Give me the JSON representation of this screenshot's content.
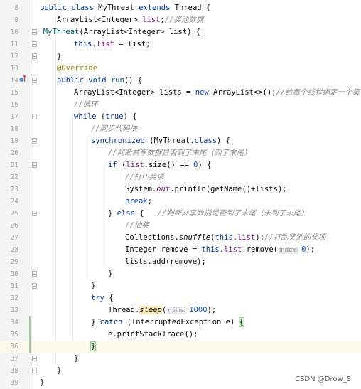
{
  "editor": {
    "lines": [
      {
        "n": "8",
        "indent": 0,
        "segs": [
          {
            "t": "public class ",
            "c": "kw"
          },
          {
            "t": "MyThreat ",
            "c": ""
          },
          {
            "t": "extends ",
            "c": "kw"
          },
          {
            "t": "Thread {",
            "c": ""
          }
        ]
      },
      {
        "n": "9",
        "indent": 1,
        "segs": [
          {
            "t": "ArrayList<Integer> ",
            "c": ""
          },
          {
            "t": "list",
            "c": "fld"
          },
          {
            "t": ";",
            "c": ""
          },
          {
            "t": "//奖池数据",
            "c": "cmt"
          }
        ]
      },
      {
        "n": "10",
        "indent": 0.2,
        "segs": [
          {
            "t": "MyThreat",
            "c": "fn"
          },
          {
            "t": "(ArrayList<Integer> list) {",
            "c": ""
          }
        ]
      },
      {
        "n": "11",
        "indent": 2,
        "segs": [
          {
            "t": "this",
            "c": "kw"
          },
          {
            "t": ".",
            "c": ""
          },
          {
            "t": "list",
            "c": "fld"
          },
          {
            "t": " = list;",
            "c": ""
          }
        ]
      },
      {
        "n": "12",
        "indent": 1,
        "segs": [
          {
            "t": "}",
            "c": ""
          }
        ]
      },
      {
        "n": "13",
        "indent": 1,
        "segs": [
          {
            "t": "@Override",
            "c": "ann"
          }
        ]
      },
      {
        "n": "14",
        "indent": 1,
        "segs": [
          {
            "t": "public void ",
            "c": "kw"
          },
          {
            "t": "run",
            "c": "fn"
          },
          {
            "t": "() {",
            "c": ""
          }
        ]
      },
      {
        "n": "15",
        "indent": 2,
        "segs": [
          {
            "t": "ArrayList<Integer> lists = ",
            "c": ""
          },
          {
            "t": "new ",
            "c": "kw"
          },
          {
            "t": "ArrayList<>();",
            "c": ""
          },
          {
            "t": "//给每个线程绑定一个集合",
            "c": "cmt"
          }
        ]
      },
      {
        "n": "16",
        "indent": 2,
        "segs": [
          {
            "t": "//循环",
            "c": "cmt"
          }
        ]
      },
      {
        "n": "17",
        "indent": 2,
        "segs": [
          {
            "t": "while ",
            "c": "kw"
          },
          {
            "t": "(",
            "c": ""
          },
          {
            "t": "true",
            "c": "kw"
          },
          {
            "t": ") {",
            "c": ""
          }
        ]
      },
      {
        "n": "18",
        "indent": 3,
        "segs": [
          {
            "t": "//同步代码块",
            "c": "cmt"
          }
        ]
      },
      {
        "n": "19",
        "indent": 3,
        "segs": [
          {
            "t": "synchronized ",
            "c": "kw"
          },
          {
            "t": "(MyThreat.",
            "c": ""
          },
          {
            "t": "class",
            "c": "kw"
          },
          {
            "t": ") {",
            "c": ""
          }
        ]
      },
      {
        "n": "20",
        "indent": 4,
        "segs": [
          {
            "t": "//判断共享数据是否到了末尾（到了末尾）",
            "c": "cmt"
          }
        ]
      },
      {
        "n": "21",
        "indent": 4,
        "segs": [
          {
            "t": "if ",
            "c": "kw"
          },
          {
            "t": "(",
            "c": ""
          },
          {
            "t": "list",
            "c": "fld"
          },
          {
            "t": ".size() == ",
            "c": ""
          },
          {
            "t": "0",
            "c": "num"
          },
          {
            "t": ") {",
            "c": ""
          }
        ]
      },
      {
        "n": "22",
        "indent": 5,
        "segs": [
          {
            "t": "//打印奖项",
            "c": "cmt"
          }
        ]
      },
      {
        "n": "23",
        "indent": 5,
        "segs": [
          {
            "t": "System.",
            "c": ""
          },
          {
            "t": "out",
            "c": "fld st"
          },
          {
            "t": ".println(getName()+lists);",
            "c": ""
          }
        ]
      },
      {
        "n": "24",
        "indent": 5,
        "segs": [
          {
            "t": "break",
            "c": "kw"
          },
          {
            "t": ";",
            "c": ""
          }
        ]
      },
      {
        "n": "25",
        "indent": 4,
        "segs": [
          {
            "t": "} ",
            "c": ""
          },
          {
            "t": "else ",
            "c": "kw"
          },
          {
            "t": "{   ",
            "c": ""
          },
          {
            "t": "//判断共享数据是否到了末尾（未到了末尾）",
            "c": "cmt"
          }
        ]
      },
      {
        "n": "26",
        "indent": 5,
        "segs": [
          {
            "t": "//抽奖",
            "c": "cmt"
          }
        ]
      },
      {
        "n": "27",
        "indent": 5,
        "segs": [
          {
            "t": "Collections.",
            "c": ""
          },
          {
            "t": "shuffle",
            "c": "st"
          },
          {
            "t": "(",
            "c": ""
          },
          {
            "t": "this",
            "c": "kw"
          },
          {
            "t": ".",
            "c": ""
          },
          {
            "t": "list",
            "c": "fld"
          },
          {
            "t": ");",
            "c": ""
          },
          {
            "t": "//打乱奖池的奖项",
            "c": "cmt"
          }
        ]
      },
      {
        "n": "28",
        "indent": 5,
        "segs": [
          {
            "t": "Integer remove = ",
            "c": ""
          },
          {
            "t": "this",
            "c": "kw"
          },
          {
            "t": ".",
            "c": ""
          },
          {
            "t": "list",
            "c": "fld"
          },
          {
            "t": ".remove(",
            "c": ""
          },
          {
            "t": "index:",
            "c": "hint"
          },
          {
            "t": "0",
            "c": "num"
          },
          {
            "t": ");",
            "c": ""
          }
        ]
      },
      {
        "n": "29",
        "indent": 5,
        "segs": [
          {
            "t": "lists.add(remove);",
            "c": ""
          }
        ]
      },
      {
        "n": "30",
        "indent": 4,
        "segs": [
          {
            "t": "}",
            "c": ""
          }
        ]
      },
      {
        "n": "31",
        "indent": 3,
        "segs": [
          {
            "t": "}",
            "c": ""
          }
        ]
      },
      {
        "n": "32",
        "indent": 3,
        "segs": [
          {
            "t": "try ",
            "c": "kw"
          },
          {
            "t": "{",
            "c": ""
          }
        ]
      },
      {
        "n": "33",
        "indent": 4,
        "segs": [
          {
            "t": "Thread.",
            "c": ""
          },
          {
            "t": "sleep",
            "c": "sthl"
          },
          {
            "t": "(",
            "c": ""
          },
          {
            "t": "millis:",
            "c": "hint"
          },
          {
            "t": "1000",
            "c": "num"
          },
          {
            "t": ");",
            "c": ""
          }
        ]
      },
      {
        "n": "34",
        "indent": 3,
        "segs": [
          {
            "t": "} ",
            "c": ""
          },
          {
            "t": "catch ",
            "c": "kw"
          },
          {
            "t": "(InterruptedException e) ",
            "c": ""
          },
          {
            "t": "{",
            "c": "brace-hl"
          }
        ]
      },
      {
        "n": "35",
        "indent": 4,
        "segs": [
          {
            "t": "e.printStackTrace();",
            "c": ""
          }
        ]
      },
      {
        "n": "36",
        "indent": 3,
        "segs": [
          {
            "t": "}",
            "c": "brace-hl"
          }
        ],
        "current": true
      },
      {
        "n": "37",
        "indent": 2,
        "segs": [
          {
            "t": "}",
            "c": ""
          }
        ]
      },
      {
        "n": "38",
        "indent": 1,
        "segs": [
          {
            "t": "}",
            "c": ""
          }
        ]
      },
      {
        "n": "39",
        "indent": 0,
        "segs": [
          {
            "t": "}",
            "c": ""
          }
        ]
      }
    ],
    "folds": [
      "10",
      "11",
      "12",
      "14",
      "17",
      "19",
      "21",
      "25",
      "30",
      "31",
      "37",
      "38"
    ],
    "gutter_icons": [
      {
        "line": "14",
        "icon": "override-method-icon"
      }
    ],
    "vcs_changed_lines": [
      "34",
      "35",
      "36"
    ]
  },
  "watermark": "CSDN @Drow_S",
  "colors": {
    "keyword": "#0033b3",
    "field": "#871094",
    "comment": "#8c8c8c",
    "annotation": "#9e880d",
    "number": "#1750eb",
    "method": "#00627a"
  }
}
